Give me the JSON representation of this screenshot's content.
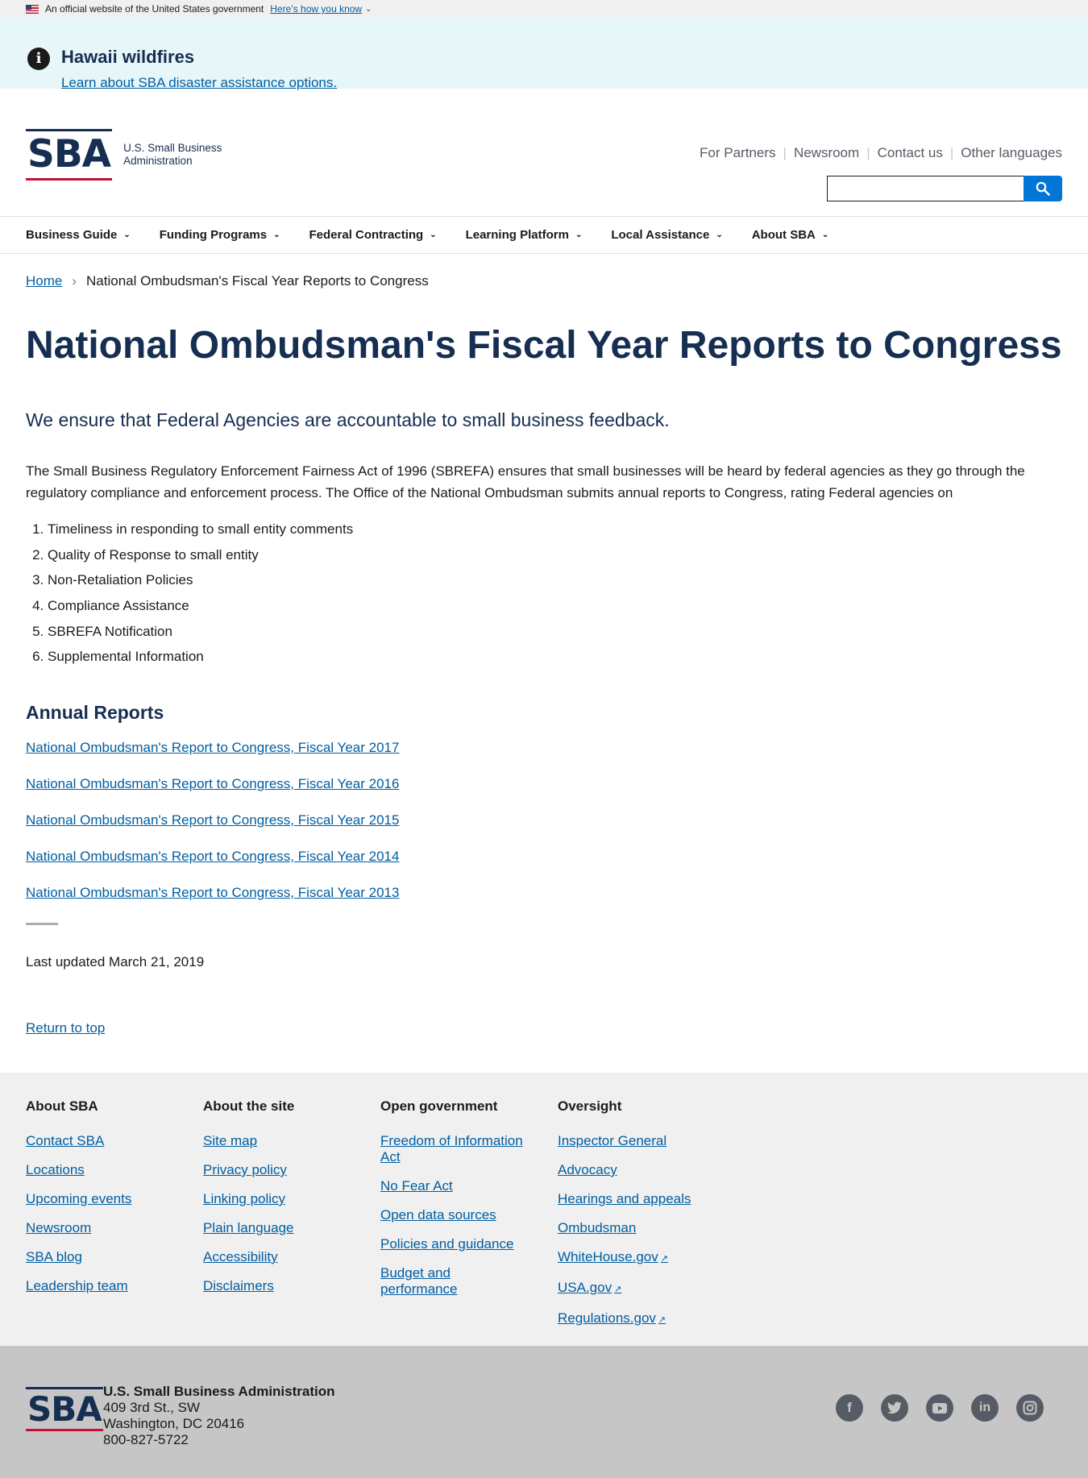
{
  "gov_banner": {
    "text": "An official website of the United States government",
    "link": "Here’s how you know"
  },
  "alert": {
    "title": "Hawaii wildfires",
    "link": "Learn about SBA disaster assistance options."
  },
  "header": {
    "logo_mark": "SBA",
    "logo_line1": "U.S. Small Business",
    "logo_line2": "Administration",
    "util_nav": [
      "For Partners",
      "Newsroom",
      "Contact us",
      "Other languages"
    ],
    "search_placeholder": ""
  },
  "main_nav": [
    "Business Guide",
    "Funding Programs",
    "Federal Contracting",
    "Learning Platform",
    "Local Assistance",
    "About SBA"
  ],
  "breadcrumb": {
    "home": "Home",
    "current": "National Ombudsman's Fiscal Year Reports to Congress"
  },
  "page": {
    "title": "National Ombudsman's Fiscal Year Reports to Congress",
    "intro": "We ensure that Federal Agencies are accountable to small business feedback.",
    "body": "The Small Business Regulatory Enforcement Fairness Act of 1996 (SBREFA) ensures that small businesses will be heard by federal agencies as they go through the regulatory compliance and enforcement process. The Office of the National Ombudsman submits annual reports to Congress, rating Federal agencies on",
    "criteria": [
      "Timeliness in responding to small entity comments",
      "Quality of Response to small entity",
      "Non-Retaliation Policies",
      "Compliance Assistance",
      "SBREFA Notification",
      "Supplemental Information"
    ],
    "section_title": "Annual Reports",
    "reports": [
      "National Ombudsman's Report to Congress, Fiscal Year 2017",
      "National Ombudsman's Report to Congress, Fiscal Year 2016",
      "National Ombudsman's Report to Congress, Fiscal Year 2015",
      "National Ombudsman's Report to Congress, Fiscal Year 2014",
      "National Ombudsman's Report to Congress, Fiscal Year 2013"
    ],
    "updated": "Last updated March 21, 2019",
    "return_top": "Return to top"
  },
  "footer": {
    "columns": [
      {
        "title": "About SBA",
        "links": [
          "Contact SBA",
          "Locations",
          "Upcoming events",
          "Newsroom",
          "SBA blog",
          "Leadership team"
        ]
      },
      {
        "title": "About the site",
        "links": [
          "Site map",
          "Privacy policy",
          "Linking policy",
          "Plain language",
          "Accessibility",
          "Disclaimers"
        ]
      },
      {
        "title": "Open government",
        "links": [
          "Freedom of Information Act",
          "No Fear Act",
          "Open data sources",
          "Policies and guidance",
          "Budget and performance"
        ]
      },
      {
        "title": "Oversight",
        "links": [
          "Inspector General",
          "Advocacy",
          "Hearings and appeals",
          "Ombudsman",
          "WhiteHouse.gov",
          "USA.gov",
          "Regulations.gov"
        ]
      }
    ],
    "agency": "U.S. Small Business Administration",
    "address1": "409 3rd St., SW",
    "address2": "Washington, DC 20416",
    "phone": "800-827-5722",
    "social": [
      "facebook-icon",
      "twitter-icon",
      "youtube-icon",
      "linkedin-icon",
      "instagram-icon"
    ]
  }
}
